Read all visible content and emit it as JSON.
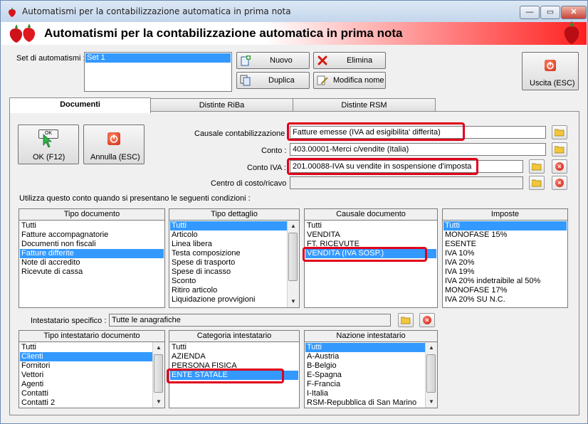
{
  "window": {
    "title": "Automatismi per la contabilizzazione automatica in prima nota",
    "minimize": "—",
    "maximize": "▭",
    "close": "✕"
  },
  "header": {
    "title": "Automatismi per la contabilizzazione automatica in prima nota"
  },
  "set": {
    "label": "Set di automatismi :",
    "items": [
      "Set 1"
    ],
    "btn_nuovo": "Nuovo",
    "btn_elimina": "Elimina",
    "btn_duplica": "Duplica",
    "btn_modifica": "Modifica nome",
    "btn_uscita": "Uscita (ESC)"
  },
  "tabs": [
    "Documenti",
    "Distinte RiBa",
    "Distinte RSM"
  ],
  "actions": {
    "ok": "OK (F12)",
    "ok_icon_text": "OK",
    "annulla": "Annulla (ESC)"
  },
  "fields": {
    "causale_label": "Causale contabilizzazione :",
    "causale_value": "Fatture emesse (IVA ad esigibilita' differita)",
    "conto_label": "Conto :",
    "conto_value": "403.00001-Merci c/vendite (Italia)",
    "contoiva_label": "Conto IVA :",
    "contoiva_value": "201.00088-IVA su vendite in sospensione d'imposta",
    "centro_label": "Centro di costo/ricavo",
    "centro_value": ""
  },
  "conditions_label": "Utilizza questo conto quando si presentano le seguenti condizioni :",
  "lists": {
    "tipo_documento": {
      "header": "Tipo documento",
      "items": [
        "Tutti",
        "Fatture accompagnatorie",
        "Documenti non fiscali",
        "Fatture differite",
        "Note di accredito",
        "Ricevute di cassa"
      ],
      "selected": 3
    },
    "tipo_dettaglio": {
      "header": "Tipo dettaglio",
      "items": [
        "Tutti",
        "Articolo",
        "Linea libera",
        "Testa composizione",
        "Spese di trasporto",
        "Spese di incasso",
        "Sconto",
        "Ritiro articolo",
        "Liquidazione provvigioni"
      ],
      "selected": 0
    },
    "causale_documento": {
      "header": "Causale documento",
      "items": [
        "Tutti",
        "VENDITA",
        "FT. RICEVUTE",
        "VENDITA (IVA SOSP.)"
      ],
      "selected": 3
    },
    "imposte": {
      "header": "Imposte",
      "items": [
        "Tutti",
        "MONOFASE 15%",
        "ESENTE",
        "IVA 10%",
        "IVA 20%",
        "IVA 19%",
        "IVA 20% indetraibile al 50%",
        "MONOFASE 17%",
        "IVA 20% SU N.C."
      ],
      "selected": 0
    },
    "tipo_intestatario": {
      "header": "Tipo intestatario documento",
      "items": [
        "Tutti",
        "Clienti",
        "Fornitori",
        "Vettori",
        "Agenti",
        "Contatti",
        "Contatti 2"
      ],
      "selected": 1
    },
    "categoria_intestatario": {
      "header": "Categoria intestatario",
      "items": [
        "Tutti",
        "AZIENDA",
        "PERSONA FISICA",
        "ENTE STATALE"
      ],
      "selected": 3
    },
    "nazione_intestatario": {
      "header": "Nazione intestatario",
      "items": [
        "Tutti",
        "A-Austria",
        "B-Belgio",
        "E-Spagna",
        "F-Francia",
        "I-Italia",
        "RSM-Repubblica di San Marino"
      ],
      "selected": 0
    }
  },
  "intestatario": {
    "label": "Intestatario specifico :",
    "value": "Tutte le anagrafiche"
  },
  "colors": {
    "selection": "#3399ff",
    "highlight": "#e0001a",
    "header_red": "#ff2020"
  }
}
